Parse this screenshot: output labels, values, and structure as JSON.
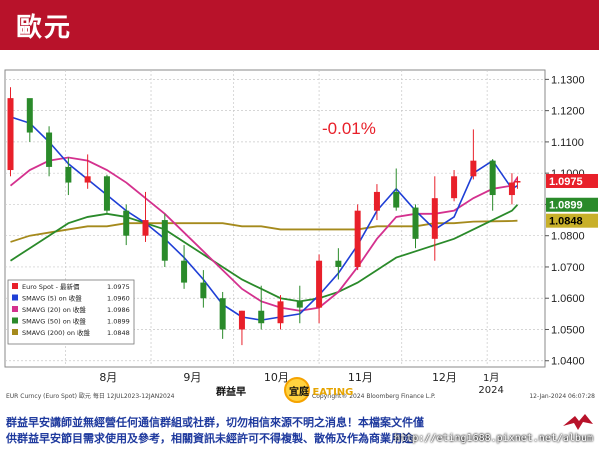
{
  "header": {
    "title": "歐元",
    "bg_color": "#b8122a"
  },
  "chart_data": {
    "type": "line",
    "annotation": "-0.01%",
    "annotation_color": "#e8202a",
    "x_ticks": [
      "8月",
      "9月",
      "10月",
      "11月",
      "12月",
      "2024\n1月"
    ],
    "x_tick_positions": [
      "2023-08-01",
      "2023-09-01",
      "2023-10-01",
      "2023-11-01",
      "2023-12-01",
      "2024-01-01"
    ],
    "ylim": [
      1.038,
      1.133
    ],
    "y_ticks": [
      1.04,
      1.05,
      1.06,
      1.07,
      1.08,
      1.09,
      1.1,
      1.11,
      1.12,
      1.13
    ],
    "y_tick_labels": [
      "1.0400",
      "1.0500",
      "1.0600",
      "1.0700",
      "1.0800",
      "1.0900",
      "1.1000",
      "1.1100",
      "1.1200",
      "1.1300"
    ],
    "grid": true,
    "legend_position": "bottom-left",
    "dates": [
      "2023-07-12",
      "2023-07-19",
      "2023-07-26",
      "2023-08-02",
      "2023-08-09",
      "2023-08-16",
      "2023-08-23",
      "2023-08-30",
      "2023-09-06",
      "2023-09-13",
      "2023-09-20",
      "2023-09-27",
      "2023-10-04",
      "2023-10-11",
      "2023-10-18",
      "2023-10-25",
      "2023-11-01",
      "2023-11-08",
      "2023-11-15",
      "2023-11-22",
      "2023-11-29",
      "2023-12-06",
      "2023-12-13",
      "2023-12-20",
      "2023-12-27",
      "2024-01-03",
      "2024-01-10",
      "2024-01-12"
    ],
    "candles": [
      {
        "o": 1.101,
        "h": 1.1275,
        "l": 1.099,
        "c": 1.124
      },
      {
        "o": 1.124,
        "h": 1.123,
        "l": 1.11,
        "c": 1.113
      },
      {
        "o": 1.113,
        "h": 1.115,
        "l": 1.099,
        "c": 1.102
      },
      {
        "o": 1.102,
        "h": 1.105,
        "l": 1.093,
        "c": 1.097
      },
      {
        "o": 1.097,
        "h": 1.106,
        "l": 1.095,
        "c": 1.099
      },
      {
        "o": 1.099,
        "h": 1.0995,
        "l": 1.087,
        "c": 1.088
      },
      {
        "o": 1.088,
        "h": 1.09,
        "l": 1.077,
        "c": 1.08
      },
      {
        "o": 1.08,
        "h": 1.094,
        "l": 1.078,
        "c": 1.085
      },
      {
        "o": 1.085,
        "h": 1.087,
        "l": 1.07,
        "c": 1.072
      },
      {
        "o": 1.072,
        "h": 1.077,
        "l": 1.063,
        "c": 1.065
      },
      {
        "o": 1.065,
        "h": 1.069,
        "l": 1.057,
        "c": 1.06
      },
      {
        "o": 1.06,
        "h": 1.062,
        "l": 1.047,
        "c": 1.05
      },
      {
        "o": 1.05,
        "h": 1.056,
        "l": 1.045,
        "c": 1.056
      },
      {
        "o": 1.056,
        "h": 1.064,
        "l": 1.05,
        "c": 1.052
      },
      {
        "o": 1.052,
        "h": 1.061,
        "l": 1.05,
        "c": 1.059
      },
      {
        "o": 1.059,
        "h": 1.064,
        "l": 1.052,
        "c": 1.057
      },
      {
        "o": 1.057,
        "h": 1.074,
        "l": 1.052,
        "c": 1.072
      },
      {
        "o": 1.072,
        "h": 1.076,
        "l": 1.066,
        "c": 1.07
      },
      {
        "o": 1.07,
        "h": 1.09,
        "l": 1.069,
        "c": 1.088
      },
      {
        "o": 1.088,
        "h": 1.0965,
        "l": 1.085,
        "c": 1.094
      },
      {
        "o": 1.094,
        "h": 1.1015,
        "l": 1.088,
        "c": 1.089
      },
      {
        "o": 1.089,
        "h": 1.09,
        "l": 1.076,
        "c": 1.079
      },
      {
        "o": 1.079,
        "h": 1.099,
        "l": 1.072,
        "c": 1.092
      },
      {
        "o": 1.092,
        "h": 1.101,
        "l": 1.091,
        "c": 1.099
      },
      {
        "o": 1.099,
        "h": 1.114,
        "l": 1.098,
        "c": 1.104
      },
      {
        "o": 1.104,
        "h": 1.1045,
        "l": 1.088,
        "c": 1.093
      },
      {
        "o": 1.093,
        "h": 1.1,
        "l": 1.09,
        "c": 1.097
      },
      {
        "o": 1.097,
        "h": 1.099,
        "l": 1.095,
        "c": 1.0975
      }
    ],
    "series": [
      {
        "name": "Euro Spot - 最新價",
        "value": "1.0975",
        "color": "#e8202a",
        "key": "close"
      },
      {
        "name": "SMAVG (5)  on 收盤",
        "value": "1.0960",
        "color": "#1f3fd6",
        "values": [
          1.118,
          1.116,
          1.11,
          1.103,
          1.098,
          1.093,
          1.088,
          1.084,
          1.079,
          1.073,
          1.066,
          1.058,
          1.054,
          1.053,
          1.054,
          1.055,
          1.061,
          1.068,
          1.077,
          1.088,
          1.095,
          1.088,
          1.082,
          1.086,
          1.1,
          1.104,
          1.095,
          1.096
        ]
      },
      {
        "name": "SMAVG (20)  on 收盤",
        "value": "1.0986",
        "color": "#d4318e",
        "values": [
          1.096,
          1.101,
          1.104,
          1.105,
          1.104,
          1.101,
          1.097,
          1.092,
          1.087,
          1.081,
          1.075,
          1.069,
          1.063,
          1.059,
          1.057,
          1.056,
          1.057,
          1.062,
          1.07,
          1.079,
          1.086,
          1.087,
          1.087,
          1.088,
          1.092,
          1.095,
          1.096,
          1.0986
        ]
      },
      {
        "name": "SMAVG (50)  on 收盤",
        "value": "1.0899",
        "color": "#2a8a2a",
        "values": [
          1.072,
          1.076,
          1.08,
          1.084,
          1.086,
          1.087,
          1.086,
          1.084,
          1.082,
          1.078,
          1.074,
          1.07,
          1.066,
          1.063,
          1.06,
          1.059,
          1.06,
          1.062,
          1.065,
          1.069,
          1.073,
          1.075,
          1.077,
          1.079,
          1.082,
          1.085,
          1.088,
          1.0899
        ]
      },
      {
        "name": "SMAVG (200)  on 收盤",
        "value": "1.0848",
        "color": "#a58a1c",
        "values": [
          1.078,
          1.08,
          1.081,
          1.082,
          1.083,
          1.083,
          1.084,
          1.084,
          1.084,
          1.084,
          1.084,
          1.084,
          1.083,
          1.083,
          1.082,
          1.082,
          1.082,
          1.082,
          1.082,
          1.083,
          1.083,
          1.083,
          1.084,
          1.084,
          1.0845,
          1.0846,
          1.0847,
          1.0848
        ]
      }
    ],
    "price_tags": [
      {
        "label": "1.0975",
        "value": 1.0975,
        "bg": "#e8202a",
        "fg": "#ffffff"
      },
      {
        "label": "1.0899",
        "value": 1.0899,
        "bg": "#2a8a2a",
        "fg": "#ffffff"
      },
      {
        "label": "1.0848",
        "value": 1.0848,
        "bg": "#c8b02a",
        "fg": "#000000"
      }
    ],
    "footer_left": "EUR Curncy (Euro Spot) 歐元  每日 12JUL2023-12JAN2024",
    "footer_copyright": "Copyright® 2024 Bloomberg Finance L.P.",
    "footer_date": "12-Jan-2024 06:07:28"
  },
  "watermark": {
    "text_left": "群益早",
    "text_right": "宜庭",
    "text_brand": "EATING"
  },
  "disclaimer": {
    "line1": "群益早安講師並無經營任何通信群組或社群，切勿相信來源不明之消息！本檔案文件僅",
    "line2": "供群益早安節目需求使用及參考，相關資訊未經許可不得複製、散佈及作為商業用途"
  },
  "blog_url": "http://eting1688.pixnet.net/album"
}
